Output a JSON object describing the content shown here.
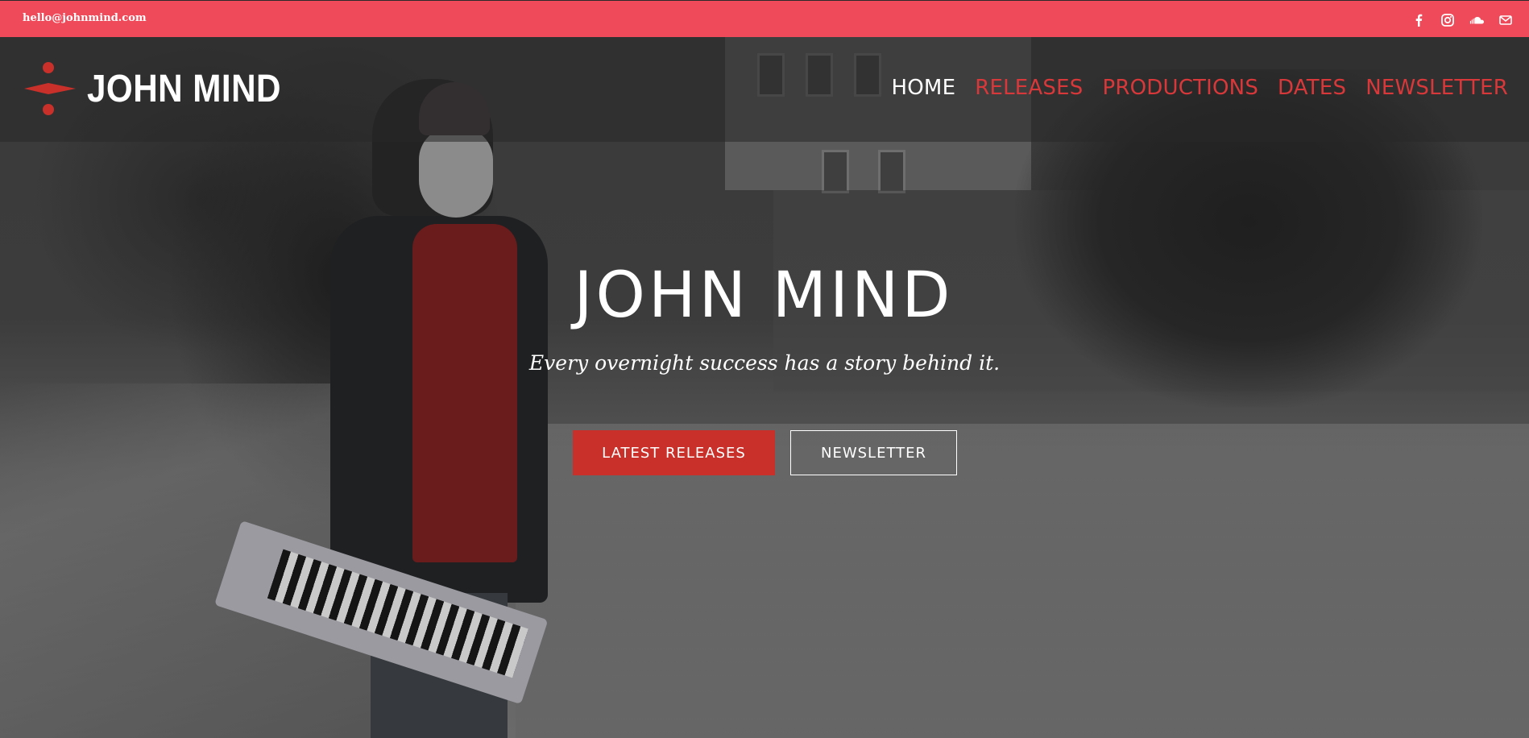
{
  "topbar": {
    "email": "hello@johnmind.com",
    "bg_color": "#ef4a5a",
    "social": [
      {
        "icon": "facebook-icon"
      },
      {
        "icon": "instagram-icon"
      },
      {
        "icon": "soundcloud-icon"
      },
      {
        "icon": "mail-icon"
      }
    ]
  },
  "header": {
    "logo_text": "JOHN MIND",
    "nav": [
      {
        "label": "HOME",
        "active": true
      },
      {
        "label": "RELEASES",
        "active": false
      },
      {
        "label": "PRODUCTIONS",
        "active": false
      },
      {
        "label": "DATES",
        "active": false
      },
      {
        "label": "NEWSLETTER",
        "active": false
      }
    ],
    "accent_color": "#d9383a"
  },
  "hero": {
    "title": "JOHN MIND",
    "subtitle": "Every overnight success has a story behind it.",
    "primary_button": "LATEST RELEASES",
    "secondary_button": "NEWSLETTER",
    "primary_color": "#c9302a"
  }
}
